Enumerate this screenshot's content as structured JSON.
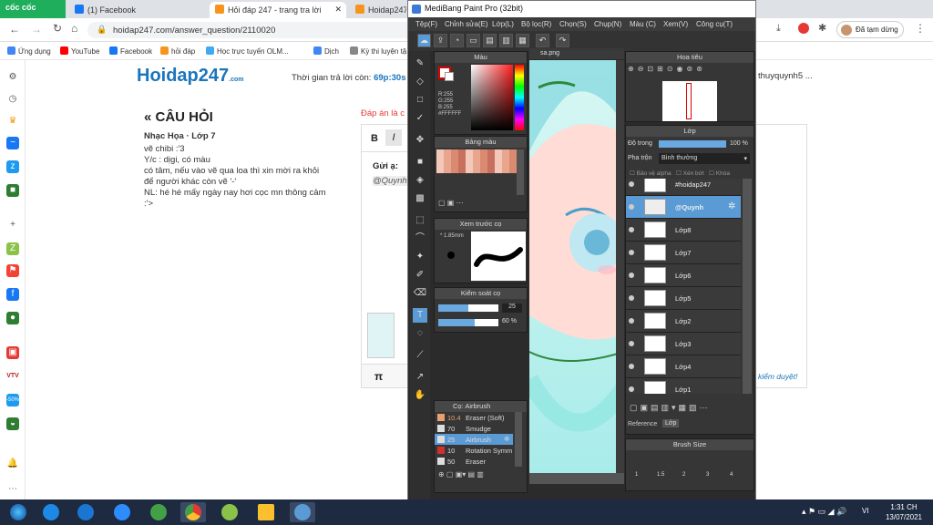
{
  "browser": {
    "brand": "cốc cốc",
    "tabs": [
      {
        "label": "(1) Facebook",
        "color": "#1877f2"
      },
      {
        "label": "Hỏi đáp 247 - trang tra lời",
        "color": "#f7941d"
      },
      {
        "label": "Hoidap247",
        "color": "#f7941d"
      }
    ],
    "url": "hoidap247.com/answer_question/2110020",
    "bookmarks": [
      {
        "label": "Ứng dụng",
        "color": "#4285f4"
      },
      {
        "label": "YouTube",
        "color": "#ff0000"
      },
      {
        "label": "Facebook",
        "color": "#1877f2"
      },
      {
        "label": "hỏi đáp",
        "color": "#f7941d"
      },
      {
        "label": "Học trực tuyến OLM...",
        "color": "#3fa9f5"
      },
      {
        "label": "Dịch",
        "color": "#4285f4"
      },
      {
        "label": "Kỳ thi luyện tậ",
        "color": "#888888"
      }
    ],
    "profile_label": "Đã tạm dừng"
  },
  "page": {
    "logo": "Hoidap247",
    "logo_sub": ".com",
    "timer_label": "Thời gian trả lời còn:",
    "timer_value": "69p:30s",
    "user": "thuyquynh5 ...",
    "section_title": "CÂU HỎI",
    "subject": "Nhạc Họa · Lớp 7",
    "question": [
      "vẽ chibi :'3",
      "Y/c : dịgi, có màu",
      "có tâm, nếu vào vẽ qua loa thì xin mời ra khỏi",
      "để người khác còn vẽ '-'",
      "NL: hé hé mấy ngày nay hơi cọc mn thông cảm",
      ":'>"
    ],
    "answer_hint": "Đáp án là c",
    "editor_bold": "B",
    "editor_italic": "I",
    "gui_label": "Gửi ạ:",
    "mention": "@Quynh",
    "pi": "π",
    "review": "kiểm duyệt!"
  },
  "medibang": {
    "title": "MediBang Paint Pro (32bit)",
    "menu": [
      "Tệp(F)",
      "Chỉnh sửa(E)",
      "Lớp(L)",
      "Bộ lọc(R)",
      "Chọn(S)",
      "Chụp(N)",
      "Màu (C)",
      "Xem(V)",
      "Công cụ(T)"
    ],
    "color_panel": "Màu",
    "rgb": [
      "R:255",
      "G:255",
      "B:255",
      "#FFFFFF"
    ],
    "palette_panel": "Bảng màu",
    "preview_panel": "Xem trước cọ",
    "brush_size": "1.85mm",
    "control_panel": "Kiểm soát cọ",
    "size_val": "25",
    "opacity_val": "60 %",
    "canvas_tab": "sa.png",
    "navigator_panel": "Hoa tiêu",
    "layer_panel": "Lớp",
    "opacity_label": "Độ trong",
    "opacity_pct": "100 %",
    "blend_label": "Pha trộn",
    "blend_value": "Bình thường",
    "chk": [
      "Bảo vệ alpha",
      "Xén bớt",
      "Khóa"
    ],
    "layers": [
      "#hoidap247",
      "@Quynh",
      "Lớp8",
      "Lớp7",
      "Lớp6",
      "Lớp5",
      "Lớp2",
      "Lớp3",
      "Lớp4",
      "Lớp1"
    ],
    "brush_panel": "Cọ: Airbrush",
    "brushes": [
      {
        "num": "10.4",
        "name": "Eraser (Soft)",
        "color": "#e8a070"
      },
      {
        "num": "70",
        "name": "Smudge",
        "color": "#dddddd"
      },
      {
        "num": "25",
        "name": "Airbrush",
        "color": "#dddddd"
      },
      {
        "num": "10",
        "name": "Rotation Symm",
        "color": "#d03030"
      },
      {
        "num": "50",
        "name": "Eraser",
        "color": "#dddddd"
      }
    ],
    "ref_tabs": [
      "Reference",
      "Lớp"
    ],
    "brushsize_panel": "Brush Size",
    "brushsize_nums": [
      "1",
      "1.5",
      "2",
      "3",
      "4"
    ]
  },
  "taskbar": {
    "time": "1:31 CH",
    "date": "13/07/2021",
    "lang": "VI"
  }
}
